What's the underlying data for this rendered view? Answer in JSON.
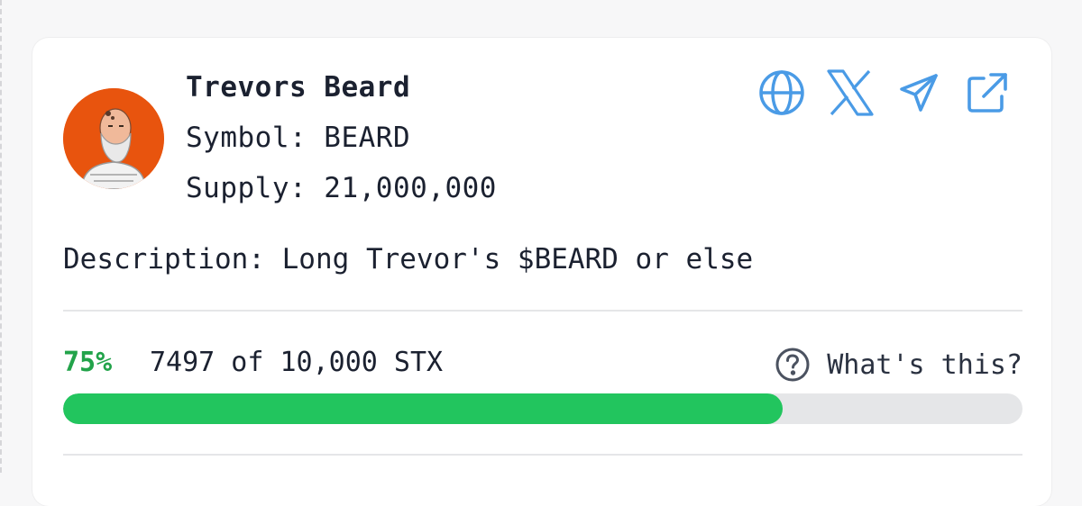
{
  "token": {
    "name": "Trevors Beard",
    "symbol_text": "Symbol: BEARD",
    "supply_text": "Supply: 21,000,000",
    "description_text": "Description: Long Trevor's $BEARD or else",
    "avatar_icon": "astronaut-avatar"
  },
  "links": [
    {
      "icon": "globe-icon",
      "color": "#4a9be6"
    },
    {
      "icon": "x-logo-icon",
      "color": "#4a9be6"
    },
    {
      "icon": "telegram-send-icon",
      "color": "#4a9be6"
    },
    {
      "icon": "external-link-icon",
      "color": "#4a9be6"
    }
  ],
  "progress": {
    "percent_label": "75%",
    "amount_text": "7497 of 10,000 STX",
    "help_label": "What's this?",
    "fraction": 0.75,
    "fill_color": "#22c55e",
    "track_color": "#e5e6e8"
  }
}
